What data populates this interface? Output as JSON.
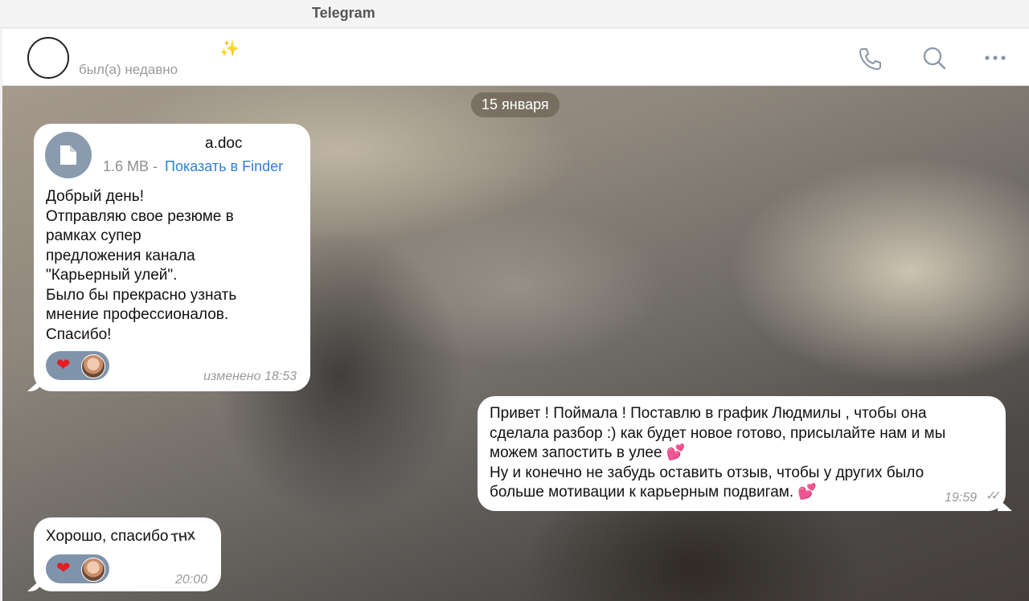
{
  "app": {
    "window_title": "Telegram"
  },
  "header": {
    "status": "был(а) недавно",
    "sparkle_icon": "sparkles-icon",
    "icons": [
      "phone-icon",
      "search-icon",
      "more-icon"
    ]
  },
  "chat": {
    "date_separator": "15 января",
    "messages": [
      {
        "direction": "incoming",
        "file": {
          "name": "a.doc",
          "size": "1.6 MB -",
          "action": "Показать в Finder",
          "icon": "document-icon"
        },
        "text": "Добрый день!\nОтправляю свое резюме в\nрамках супер\nпредложения канала\n\"Карьерный улей\".\nБыло бы прекрасно узнать\nмнение профессионалов.\nСпасибо!",
        "reactions": [
          "heart-icon",
          "avatar"
        ],
        "time": "изменено 18:53"
      },
      {
        "direction": "outgoing",
        "text_part1": "Привет ! Поймала ! Поставлю в график Людмилы , чтобы она\nсделала разбор :) как будет новое готово, присылайте нам и мы\nможем запостить в улее",
        "text_part2": "Ну и конечно не забудь оставить отзыв, чтобы у других было\nбольше мотивации к карьерным подвигам.",
        "emoji": "💕",
        "time": "19:59",
        "status_icon": "double-check-icon"
      },
      {
        "direction": "incoming",
        "text": "Хорошо, спасибо",
        "sticker": "THX",
        "reactions": [
          "heart-icon",
          "avatar"
        ],
        "time": "20:00"
      }
    ]
  },
  "colors": {
    "link": "#2f7fd3",
    "reaction_bg": "#7f93ab",
    "heart": "#e51c23",
    "file_icon_bg": "#8a9bb0"
  }
}
